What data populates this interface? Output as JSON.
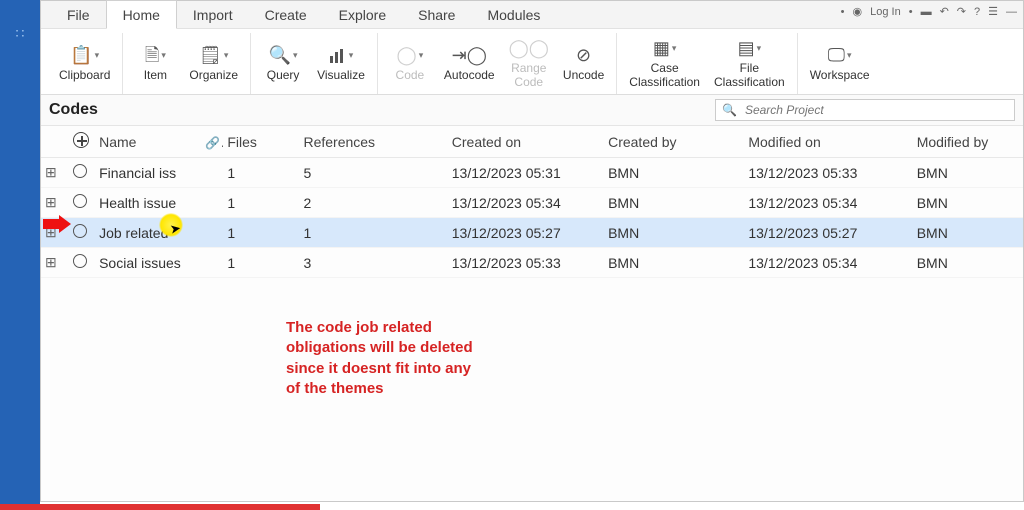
{
  "titlebar": {
    "login": "Log In"
  },
  "menu": {
    "items": [
      "File",
      "Home",
      "Import",
      "Create",
      "Explore",
      "Share",
      "Modules"
    ],
    "active_index": 1
  },
  "ribbon": {
    "clipboard": "Clipboard",
    "item": "Item",
    "organize": "Organize",
    "query": "Query",
    "visualize": "Visualize",
    "code": "Code",
    "autocode": "Autocode",
    "rangecode_l1": "Range",
    "rangecode_l2": "Code",
    "uncode": "Uncode",
    "caseclass_l1": "Case",
    "caseclass_l2": "Classification",
    "fileclass_l1": "File",
    "fileclass_l2": "Classification",
    "workspace": "Workspace"
  },
  "panel": {
    "title": "Codes",
    "search_placeholder": "Search Project"
  },
  "columns": {
    "name": "Name",
    "files": "Files",
    "references": "References",
    "created_on": "Created on",
    "created_by": "Created by",
    "modified_on": "Modified on",
    "modified_by": "Modified by"
  },
  "rows": [
    {
      "name": "Financial iss",
      "files": "1",
      "refs": "5",
      "con": "13/12/2023 05:31",
      "cby": "BMN",
      "mon": "13/12/2023 05:33",
      "mby": "BMN",
      "selected": false
    },
    {
      "name": "Health issue",
      "files": "1",
      "refs": "2",
      "con": "13/12/2023 05:34",
      "cby": "BMN",
      "mon": "13/12/2023 05:34",
      "mby": "BMN",
      "selected": false
    },
    {
      "name": "Job related",
      "files": "1",
      "refs": "1",
      "con": "13/12/2023 05:27",
      "cby": "BMN",
      "mon": "13/12/2023 05:27",
      "mby": "BMN",
      "selected": true
    },
    {
      "name": "Social issues",
      "files": "1",
      "refs": "3",
      "con": "13/12/2023 05:33",
      "cby": "BMN",
      "mon": "13/12/2023 05:34",
      "mby": "BMN",
      "selected": false
    }
  ],
  "annotation": "The code job related obligations will be deleted since it doesnt fit into any of the themes"
}
